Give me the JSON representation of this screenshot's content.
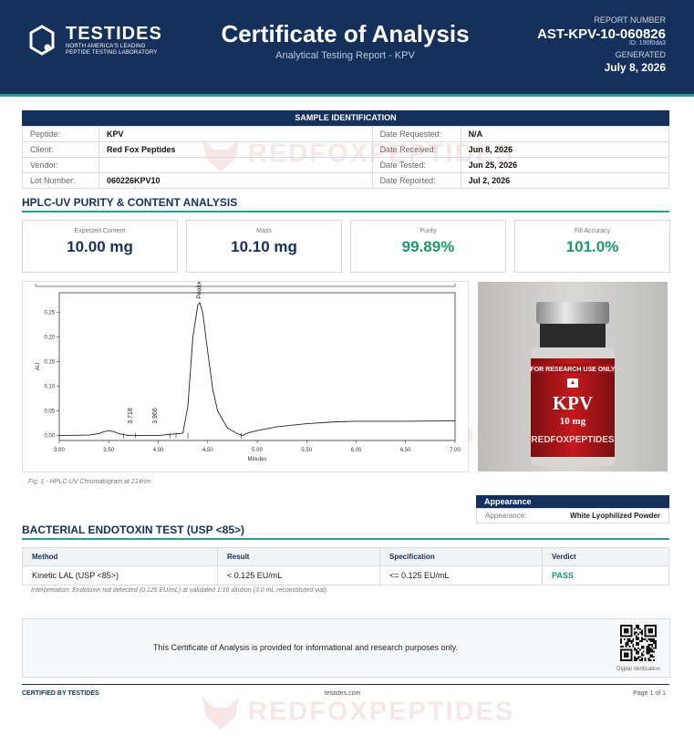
{
  "brand": {
    "name": "TESTIDES",
    "tagline": "NORTH AMERICA'S LEADING PEPTIDE TESTING LABORATORY"
  },
  "header": {
    "title": "Certificate of Analysis",
    "subtitle": "Analytical Testing Report  -  KPV"
  },
  "report": {
    "number_label": "REPORT NUMBER",
    "number": "AST-KPV-10-060826",
    "id_line": "ID: 190f0da3",
    "generated_label": "GENERATED",
    "generated_date": "July 8, 2026"
  },
  "sample": {
    "section_title": "SAMPLE IDENTIFICATION",
    "rows": [
      {
        "l1": "Peptide:",
        "v1": "KPV",
        "l2": "Date Requested:",
        "v2": "N/A"
      },
      {
        "l1": "Client:",
        "v1": "Red Fox Peptides",
        "l2": "Date Received:",
        "v2": "Jun 8, 2026"
      },
      {
        "l1": "Vendor:",
        "v1": "",
        "l2": "Date Tested:",
        "v2": "Jun 25, 2026"
      },
      {
        "l1": "Lot Number:",
        "v1": "060226KPV10",
        "l2": "Date Reported:",
        "v2": "Jul 2, 2026"
      }
    ]
  },
  "hplc": {
    "section_title": "HPLC-UV PURITY & CONTENT ANALYSIS",
    "cards": [
      {
        "label": "Expected Content",
        "value": "10.00 mg"
      },
      {
        "label": "Mass",
        "value": "10.10 mg"
      },
      {
        "label": "Purity",
        "value": "99.89%"
      },
      {
        "label": "Fill Accuracy",
        "value": "101.0%"
      }
    ],
    "fig_caption": "Fig. 1  -  HPLC-UV Chromatogram at 214nm"
  },
  "chart_data": {
    "type": "line",
    "title": "",
    "xlabel": "Minutes",
    "ylabel": "AU",
    "xlim": [
      3.0,
      7.0
    ],
    "ylim": [
      -0.01,
      0.29
    ],
    "xticks": [
      "3.00",
      "3.50",
      "4.00",
      "4.50",
      "5.00",
      "5.50",
      "6.00",
      "6.50",
      "7.00"
    ],
    "yticks": [
      "0.00",
      "0.05",
      "0.10",
      "0.15",
      "0.20",
      "0.25"
    ],
    "grid": false,
    "x": [
      3.0,
      3.3,
      3.4,
      3.45,
      3.5,
      3.55,
      3.6,
      3.7,
      4.0,
      4.25,
      4.3,
      4.35,
      4.4,
      4.42,
      4.45,
      4.5,
      4.55,
      4.6,
      4.7,
      4.8,
      4.85,
      4.9,
      5.0,
      5.2,
      5.5,
      5.8,
      6.0,
      6.5,
      7.0
    ],
    "y": [
      0.0,
      0.001,
      0.004,
      0.008,
      0.01,
      0.008,
      0.004,
      0.0,
      0.0,
      0.005,
      0.06,
      0.2,
      0.265,
      0.27,
      0.25,
      0.17,
      0.095,
      0.05,
      0.015,
      0.004,
      0.0,
      0.005,
      0.01,
      0.018,
      0.024,
      0.028,
      0.029,
      0.029,
      0.03
    ],
    "peak_labels": [
      {
        "x": 3.718,
        "text": "3.718"
      },
      {
        "x": 3.966,
        "text": "3.966"
      },
      {
        "x": 4.416,
        "text": "Peak#1 - 4.416"
      }
    ]
  },
  "photo": {
    "band": "FOR RESEARCH USE ONLY",
    "product": "KPV",
    "dose": "10 mg",
    "maker": "REDFOXPEPTIDES"
  },
  "appearance": {
    "title": "Appearance",
    "label": "Appearance:",
    "value": "White Lyophilized Powder"
  },
  "endotoxin": {
    "section_title": "BACTERIAL ENDOTOXIN TEST (USP <85>)",
    "headers": {
      "method": "Method",
      "result": "Result",
      "spec": "Specification",
      "verdict": "Verdict"
    },
    "row": {
      "method": "Kinetic LAL (USP <85>)",
      "result": "< 0.125 EU/mL",
      "spec": "<= 0.125 EU/mL",
      "verdict": "PASS"
    },
    "interpretation": "Interpretation: Endotoxin not detected (0.125 EU/mL) at validated 1:16 dilution (3.0 mL reconstituted vial)."
  },
  "disclaimer": {
    "text": "This Certificate of Analysis is provided for informational and research purposes only.",
    "qr_label": "Digital Verification"
  },
  "footer": {
    "certified": "CERTIFIED BY TESTIDES",
    "site": "testides.com",
    "page": "Page 1 of 1"
  },
  "watermark": "REDFOXPEPTIDES",
  "colors": {
    "navy": "#15305a",
    "teal": "#2a9d8f",
    "green": "#1a9a68"
  }
}
